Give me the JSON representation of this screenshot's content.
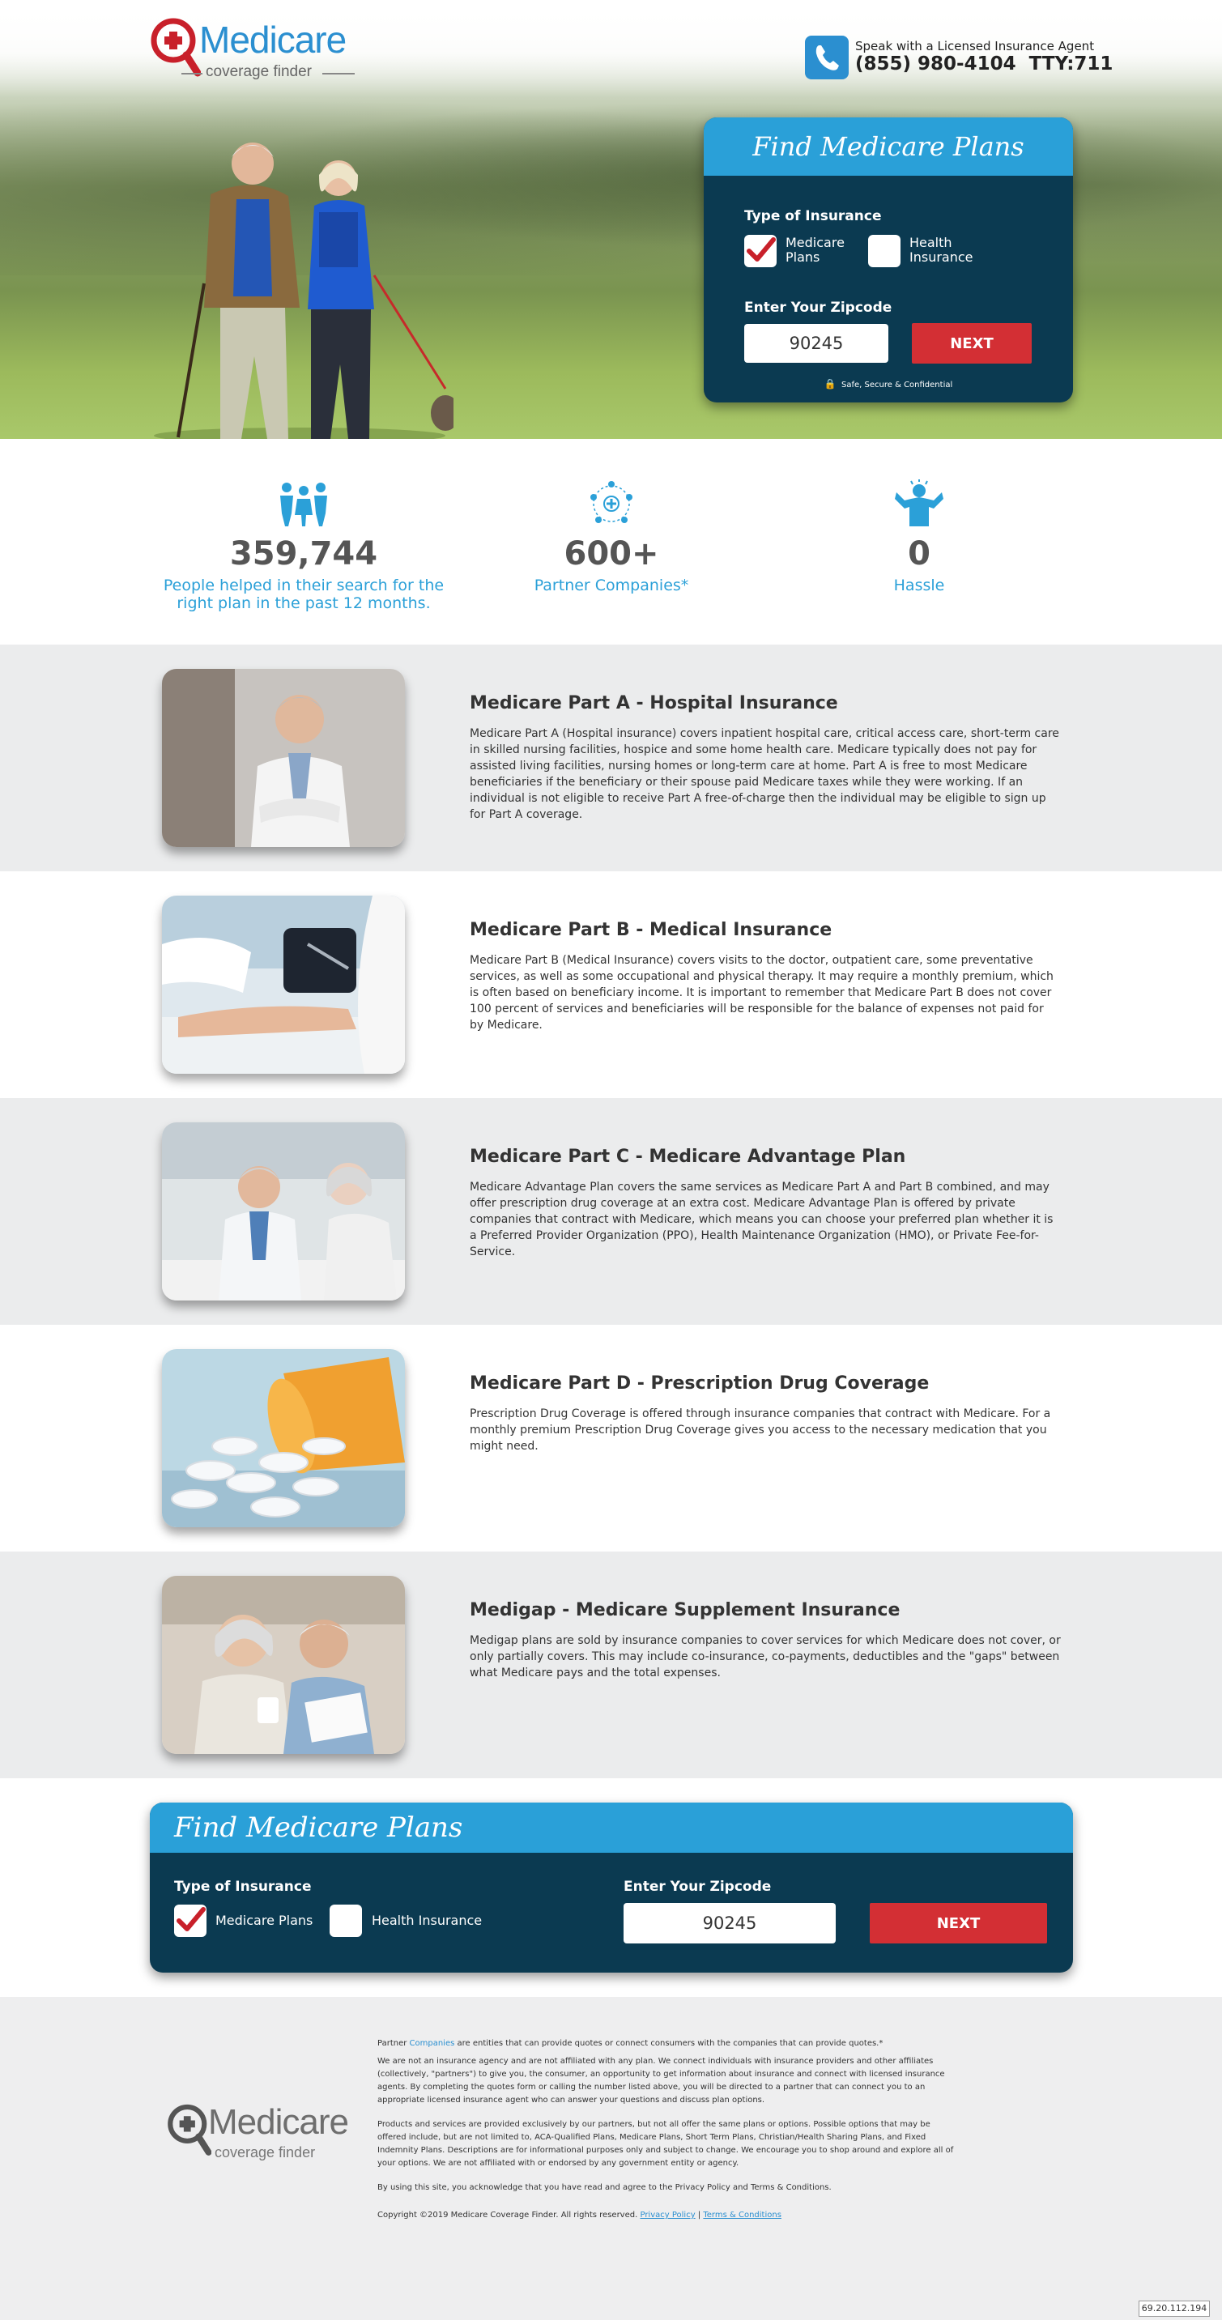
{
  "brand": {
    "name": "Medicare",
    "tagline": "coverage finder"
  },
  "header": {
    "speak_text": "Speak with a Licensed Insurance Agent",
    "phone": "(855) 980-4104",
    "tty": "TTY:711"
  },
  "hero_form": {
    "title": "Find Medicare Plans",
    "type_label": "Type of Insurance",
    "option_medicare": "Medicare Plans",
    "option_health": "Health Insurance",
    "medicare_checked": true,
    "health_checked": false,
    "zip_label": "Enter Your Zipcode",
    "zip_value": "90245",
    "next_label": "NEXT",
    "secure_text": "Safe, Secure & Confidential"
  },
  "stats": [
    {
      "icon": "people-icon",
      "number": "359,744",
      "text": "People helped in their search for the right plan in the past 12 months."
    },
    {
      "icon": "network-icon",
      "number": "600+",
      "text": "Partner Companies*"
    },
    {
      "icon": "no-stress-icon",
      "number": "0",
      "text": "Hassle"
    }
  ],
  "sections": [
    {
      "title": "Medicare Part A - Hospital Insurance",
      "text": "Medicare Part A (Hospital insurance) covers inpatient hospital care, critical access care, short-term care in skilled nursing facilities, hospice and some home health care. Medicare typically does not pay for assisted living facilities, nursing homes or long-term care at home. Part A is free to most Medicare beneficiaries if the beneficiary or their spouse paid Medicare taxes while they were working. If an individual is not eligible to receive Part A free-of-charge then the individual may be eligible to sign up for Part A coverage."
    },
    {
      "title": "Medicare Part B - Medical Insurance",
      "text": "Medicare Part B (Medical Insurance) covers visits to the doctor, outpatient care, some preventative services, as well as some occupational and physical therapy. It may require a monthly premium, which is often based on beneficiary income. It is important to remember that Medicare Part B does not cover 100 percent of services and beneficiaries will be responsible for the balance of expenses not paid for by Medicare."
    },
    {
      "title": "Medicare Part C - Medicare Advantage Plan",
      "text": "Medicare Advantage Plan covers the same services as Medicare Part A and Part B combined, and may offer prescription drug coverage at an extra cost. Medicare Advantage Plan is offered by private companies that contract with Medicare, which means you can choose your preferred plan whether it is a Preferred Provider Organization (PPO), Health Maintenance Organization (HMO), or Private Fee-for-Service."
    },
    {
      "title": "Medicare Part D - Prescription Drug Coverage",
      "text": "Prescription Drug Coverage is offered through insurance companies that contract with Medicare. For a monthly premium Prescription Drug Coverage gives you access to the necessary medication that you might need."
    },
    {
      "title": "Medigap - Medicare Supplement Insurance",
      "text": "Medigap plans are sold by insurance companies to cover services for which Medicare does not cover, or only partially covers. This may include co-insurance, co-payments, deductibles and the \"gaps\" between what Medicare pays and the total expenses."
    }
  ],
  "bottom_form": {
    "title": "Find Medicare Plans",
    "type_label": "Type of Insurance",
    "option_medicare": "Medicare Plans",
    "option_health": "Health Insurance",
    "zip_label": "Enter Your Zipcode",
    "zip_value": "90245",
    "next_label": "NEXT"
  },
  "footer": {
    "partner_prefix": "Partner ",
    "partner_link": "Companies",
    "partner_suffix": " are entities that can provide quotes or connect consumers with the companies that can provide quotes.*",
    "disclaimer_1": "We are not an insurance agency and are not affiliated with any plan. We connect individuals with insurance providers and other affiliates (collectively, \"partners\") to give you, the consumer, an opportunity to get information about insurance and connect with licensed insurance agents. By completing the quotes form or calling the number listed above, you will be directed to a partner that can connect you to an appropriate licensed insurance agent who can answer your questions and discuss plan options.",
    "disclaimer_2": "Products and services are provided exclusively by our partners, but not all offer the same plans or options. Possible options that may be offered include, but are not limited to, ACA-Qualified Plans, Medicare Plans, Short Term Plans, Christian/Health Sharing Plans, and Fixed Indemnity Plans. Descriptions are for informational purposes only and subject to change. We encourage you to shop around and explore all of your options. We are not affiliated with or endorsed by any government entity or agency.",
    "acknowledge": "By using this site, you acknowledge that you have read and agree to the Privacy Policy and Terms & Conditions.",
    "copyright": "Copyright ©2019 Medicare Coverage Finder. All rights reserved.",
    "privacy_link": "Privacy Policy",
    "separator": "|",
    "terms_link": "Terms & Conditions"
  },
  "ip_address": "69.20.112.194",
  "colors": {
    "brand_blue": "#2b8fd0",
    "form_navy": "#0b3a51",
    "form_header": "#2aa0d8",
    "next_red": "#d32f34",
    "stat_blue": "#2ba0d8"
  }
}
